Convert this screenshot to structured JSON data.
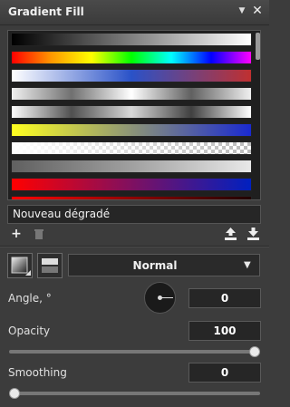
{
  "panel": {
    "title": "Gradient Fill",
    "menu_icon": "chevron-down-icon",
    "close_icon": "close-icon"
  },
  "gradients": [
    {
      "id": "black-white",
      "css": "linear-gradient(to right,#000,#fff)"
    },
    {
      "id": "rainbow",
      "css": "linear-gradient(to right,#ff0000,#ff9900,#ffff00,#00ff00,#00ffff,#0000ff,#ff00ff)"
    },
    {
      "id": "blue-red",
      "css": "linear-gradient(to right,#ffffff,#2a52c8,#c03030)"
    },
    {
      "id": "silver",
      "css": "linear-gradient(to right,#f0f0f0,#707070,#ffffff,#606060,#f0f0f0)"
    },
    {
      "id": "chrome",
      "css": "linear-gradient(to right,#ffffff,#505050,#d8d8d8,#404040,#ffffff)"
    },
    {
      "id": "yellow-blue",
      "css": "linear-gradient(to right,#ffff20,#1a2ad0)"
    },
    {
      "id": "white-transparent",
      "css": "linear-gradient(to right,#ffffff,rgba(255,255,255,0))"
    },
    {
      "id": "gray",
      "css": "linear-gradient(to right,#606060,#a0a0a0,#e8e8e8)"
    },
    {
      "id": "red-blue",
      "css": "linear-gradient(to right,#ff0000,#0020c0)"
    },
    {
      "id": "red-dark",
      "css": "linear-gradient(to right,#ff0000,#200000)"
    }
  ],
  "name_field": {
    "value": "Nouveau dégradé"
  },
  "list_actions": {
    "add_icon": "plus-icon",
    "delete_icon": "trash-icon",
    "export_icon": "export-icon",
    "import_icon": "import-icon"
  },
  "blend": {
    "mode": "Normal"
  },
  "angle": {
    "label": "Angle, °",
    "value": "0"
  },
  "opacity": {
    "label": "Opacity",
    "value": "100",
    "level": 1.0
  },
  "smoothing": {
    "label": "Smoothing",
    "value": "0",
    "level": 0.0
  },
  "colors": {
    "background": "#3c3c3c",
    "field": "#262626",
    "accent": "#eaeaea"
  }
}
